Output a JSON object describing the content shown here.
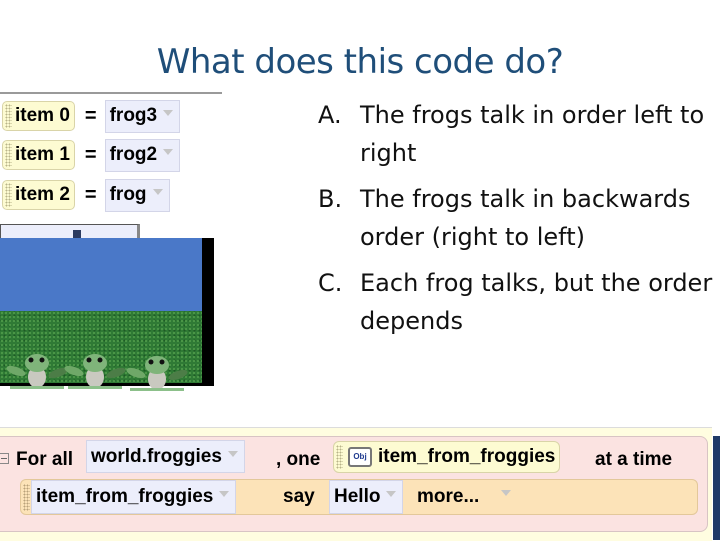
{
  "slide": {
    "title": "What does this code do?"
  },
  "assignments": [
    {
      "item": "item 0",
      "equals": "=",
      "value": "frog3"
    },
    {
      "item": "item 1",
      "equals": "=",
      "value": "frog2"
    },
    {
      "item": "item 2",
      "equals": "=",
      "value": "frog"
    }
  ],
  "world_view": {
    "sky_color": "#4a78c8",
    "ground_color": "#2f7a35",
    "frog_count": 3
  },
  "answers": [
    {
      "letter": "A.",
      "text": "The frogs talk in order left to right"
    },
    {
      "letter": "B.",
      "text": "The frogs talk in backwards order (right to left)"
    },
    {
      "letter": "C.",
      "text": "Each frog talks, but the order depends"
    }
  ],
  "code": {
    "for_all_label": "For all",
    "list_value": "world.froggies",
    "one_label": ", one",
    "obj_icon_label": "Obj",
    "item_var": "item_from_froggies",
    "at_a_time_label": "at a time",
    "say_target": "item_from_froggies",
    "say_label": "say",
    "say_value": "Hello",
    "more_label": "more..."
  }
}
